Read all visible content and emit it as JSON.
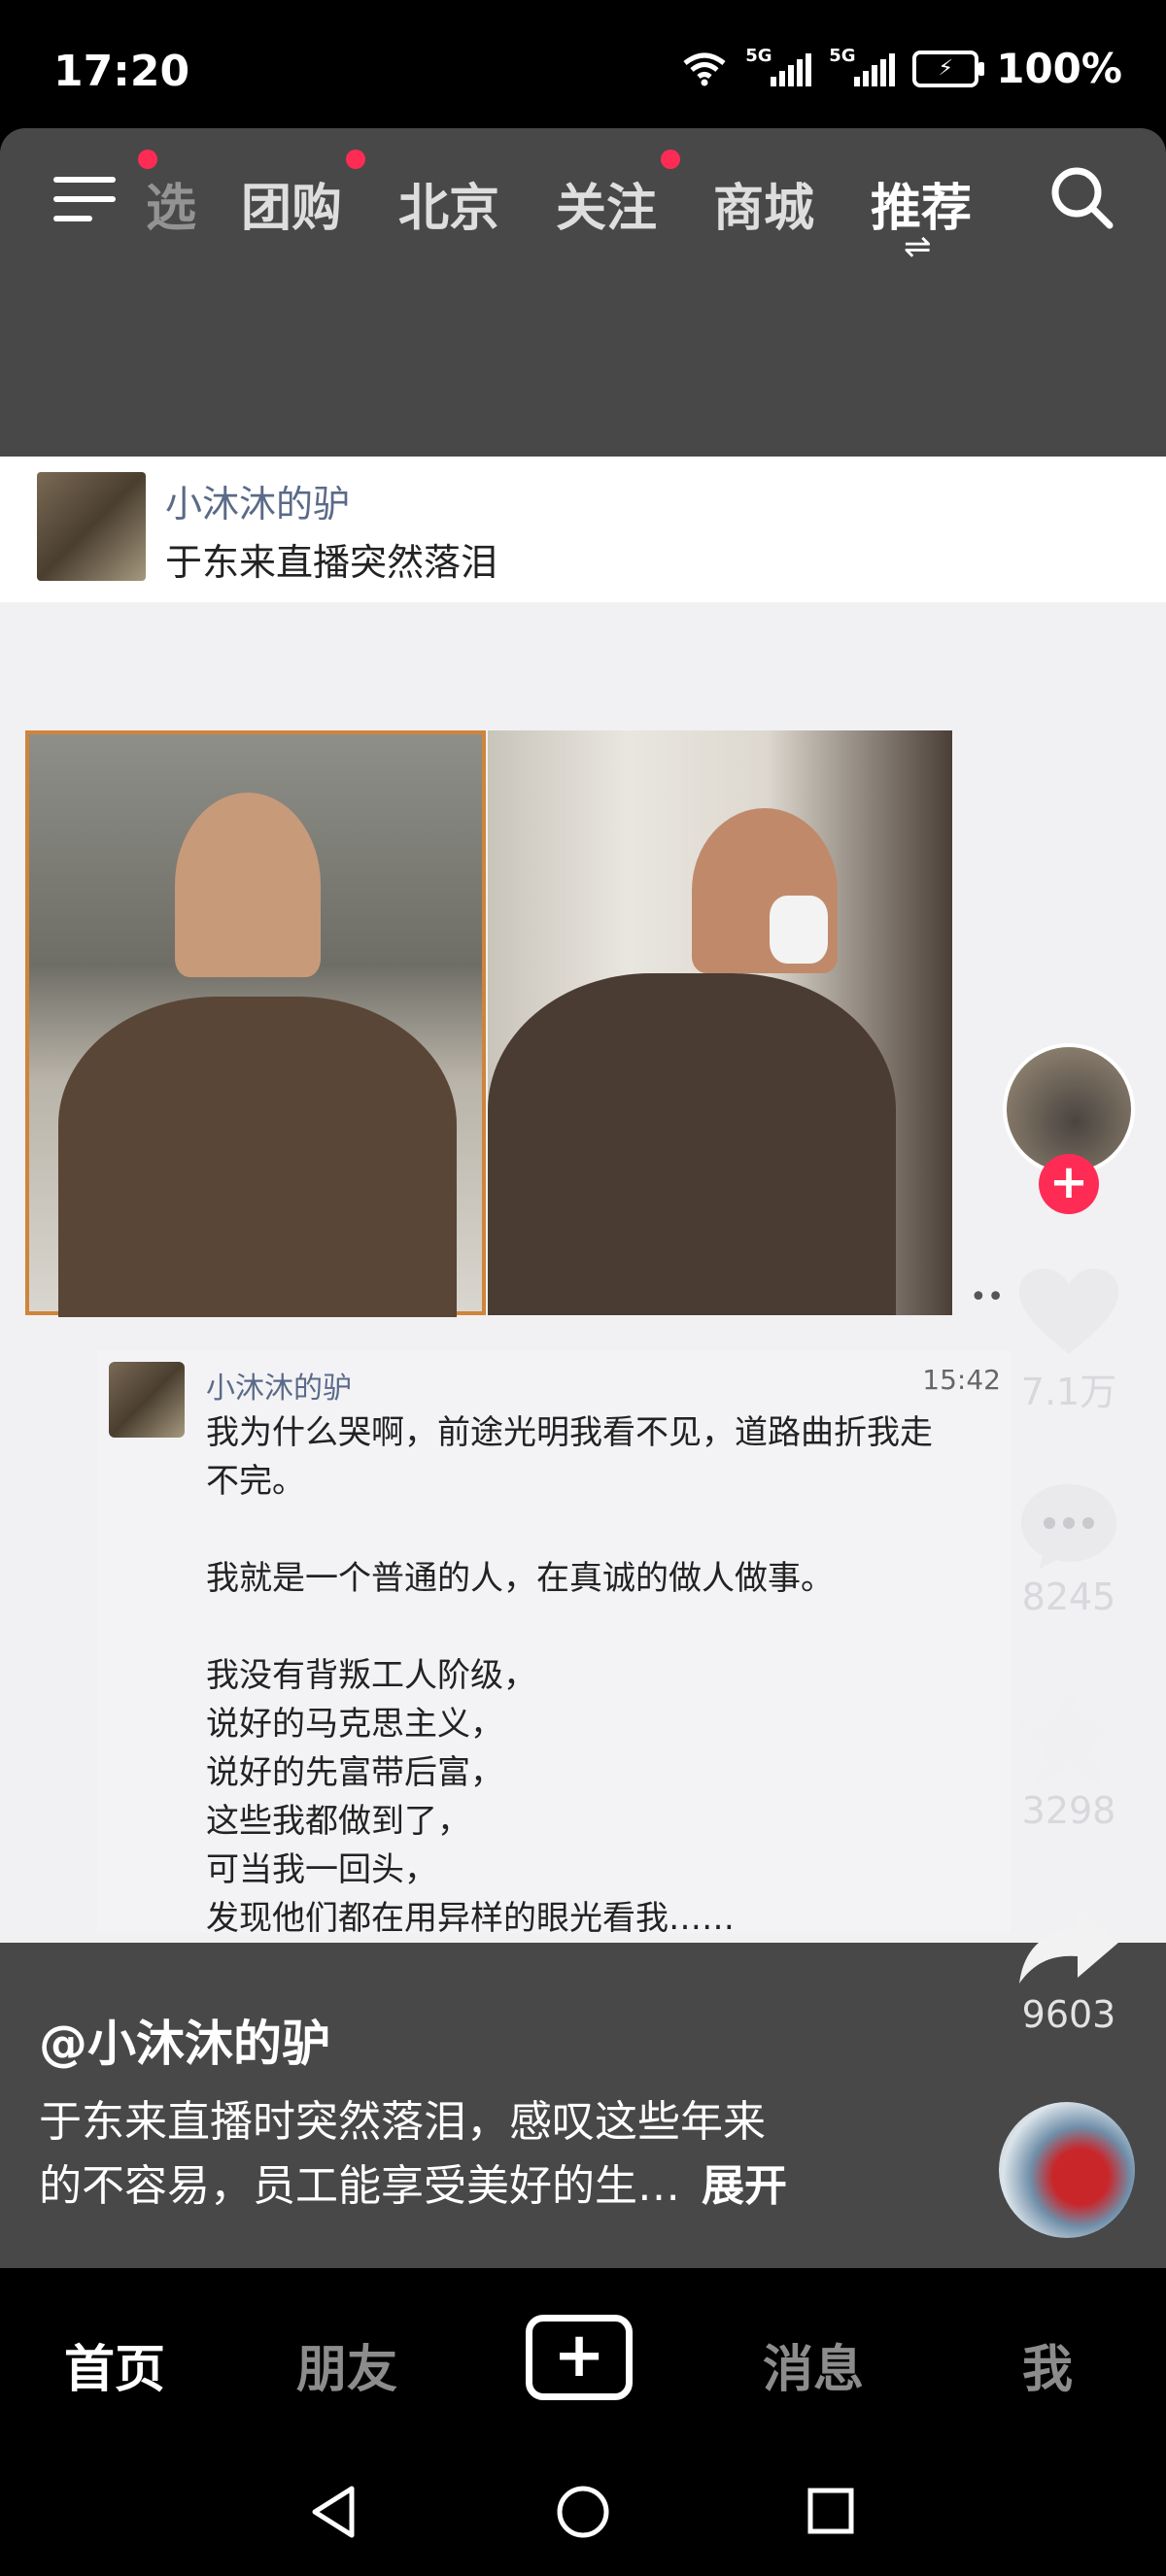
{
  "status_bar": {
    "time": "17:20",
    "network_1": "5G",
    "network_2": "5G",
    "battery": "100%"
  },
  "top_nav": {
    "tabs": [
      {
        "label": "选",
        "badge": true
      },
      {
        "label": "团购",
        "badge": true
      },
      {
        "label": "北京",
        "badge": false
      },
      {
        "label": "关注",
        "badge": true
      },
      {
        "label": "商城",
        "badge": false
      },
      {
        "label": "推荐",
        "badge": false,
        "active": true
      }
    ]
  },
  "post_card": {
    "username": "小沐沐的驴",
    "title": "于东来直播突然落泪"
  },
  "chat": {
    "name": "小沐沐的驴",
    "time": "15:42",
    "line1": "我为什么哭啊，前途光明我看不见，道路曲折我走",
    "line2": "不完。",
    "line3": "我就是一个普通的人，在真诚的做人做事。",
    "line4": "我没有背叛工人阶级，",
    "line5": "说好的马克思主义，",
    "line6": "说好的先富带后富，",
    "line7": "这些我都做到了，",
    "line8": "可当我一回头，",
    "line9": "发现他们都在用异样的眼光看我……"
  },
  "actions": {
    "likes": "7.1万",
    "comments": "8245",
    "favorites": "3298",
    "shares": "9603"
  },
  "caption": {
    "author": "@小沐沐的驴",
    "text_line1": "于东来直播时突然落泪，感叹这些年来",
    "text_line2": "的不容易，员工能享受美好的生…",
    "expand": "展开"
  },
  "bottom_nav": {
    "home": "首页",
    "friends": "朋友",
    "messages": "消息",
    "me": "我"
  },
  "colors": {
    "accent": "#fe2c55",
    "app_bg": "#484848"
  }
}
